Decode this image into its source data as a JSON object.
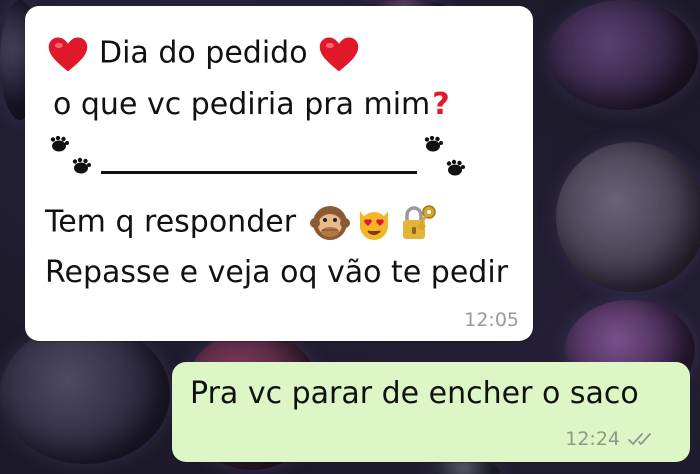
{
  "messages": {
    "incoming": {
      "line1": "Dia do pedido",
      "line2": "o que vc pediria pra mim",
      "line3": "Tem q responder",
      "line4": "Repasse e veja oq vão te pedir",
      "time": "12:05",
      "emoji": {
        "heart": "red-heart",
        "question": "?",
        "paws": "paw-prints",
        "monkey": "speak-no-evil-monkey",
        "cat": "heart-eyes-cat",
        "lock": "locked-with-key"
      }
    },
    "outgoing": {
      "text": "Pra vc parar de encher o saco",
      "time": "12:24",
      "status": "read-double-check"
    }
  },
  "colors": {
    "incoming_bubble": "#ffffff",
    "outgoing_bubble": "#dcf7c5",
    "heart": "#e0182a",
    "timestamp": "#9a9a9a"
  }
}
